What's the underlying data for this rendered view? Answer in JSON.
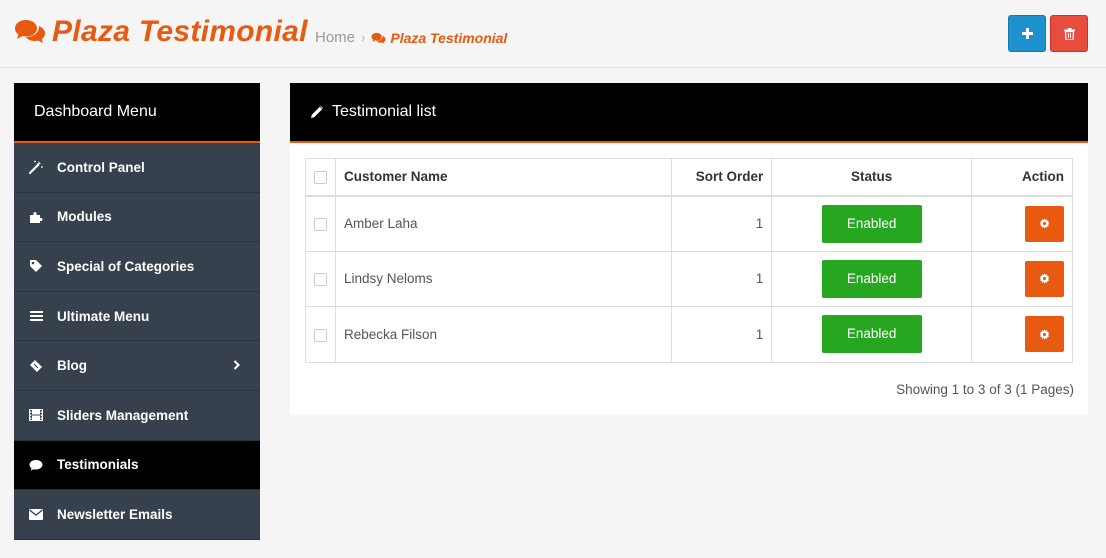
{
  "header": {
    "title": "Plaza Testimonial",
    "breadcrumb": {
      "home": "Home",
      "separator": "›",
      "current": "Plaza Testimonial"
    },
    "add_button_icon": "plus-icon",
    "delete_button_icon": "trash-icon"
  },
  "sidebar": {
    "heading": "Dashboard Menu",
    "items": [
      {
        "label": "Control Panel",
        "icon": "magic-wand-icon",
        "active": false
      },
      {
        "label": "Modules",
        "icon": "puzzle-icon",
        "active": false
      },
      {
        "label": "Special of Categories",
        "icon": "tag-icon",
        "active": false
      },
      {
        "label": "Ultimate Menu",
        "icon": "bars-icon",
        "active": false
      },
      {
        "label": "Blog",
        "icon": "ticket-icon",
        "active": false,
        "has_submenu": true
      },
      {
        "label": "Sliders Management",
        "icon": "film-icon",
        "active": false
      },
      {
        "label": "Testimonials",
        "icon": "comment-icon",
        "active": true
      },
      {
        "label": "Newsletter Emails",
        "icon": "envelope-icon",
        "active": false
      }
    ]
  },
  "panel": {
    "title": "Testimonial list",
    "columns": {
      "name": "Customer Name",
      "sort": "Sort Order",
      "status": "Status",
      "action": "Action"
    },
    "rows": [
      {
        "name": "Amber Laha",
        "sort": "1",
        "status": "Enabled"
      },
      {
        "name": "Lindsy Neloms",
        "sort": "1",
        "status": "Enabled"
      },
      {
        "name": "Rebecka Filson",
        "sort": "1",
        "status": "Enabled"
      }
    ],
    "pagination": "Showing 1 to 3 of 3 (1 Pages)"
  },
  "colors": {
    "accent": "#e85a10",
    "primary": "#1e91cf",
    "danger": "#e74c3c",
    "success": "#26a621",
    "sidebar_bg": "#36414d"
  }
}
